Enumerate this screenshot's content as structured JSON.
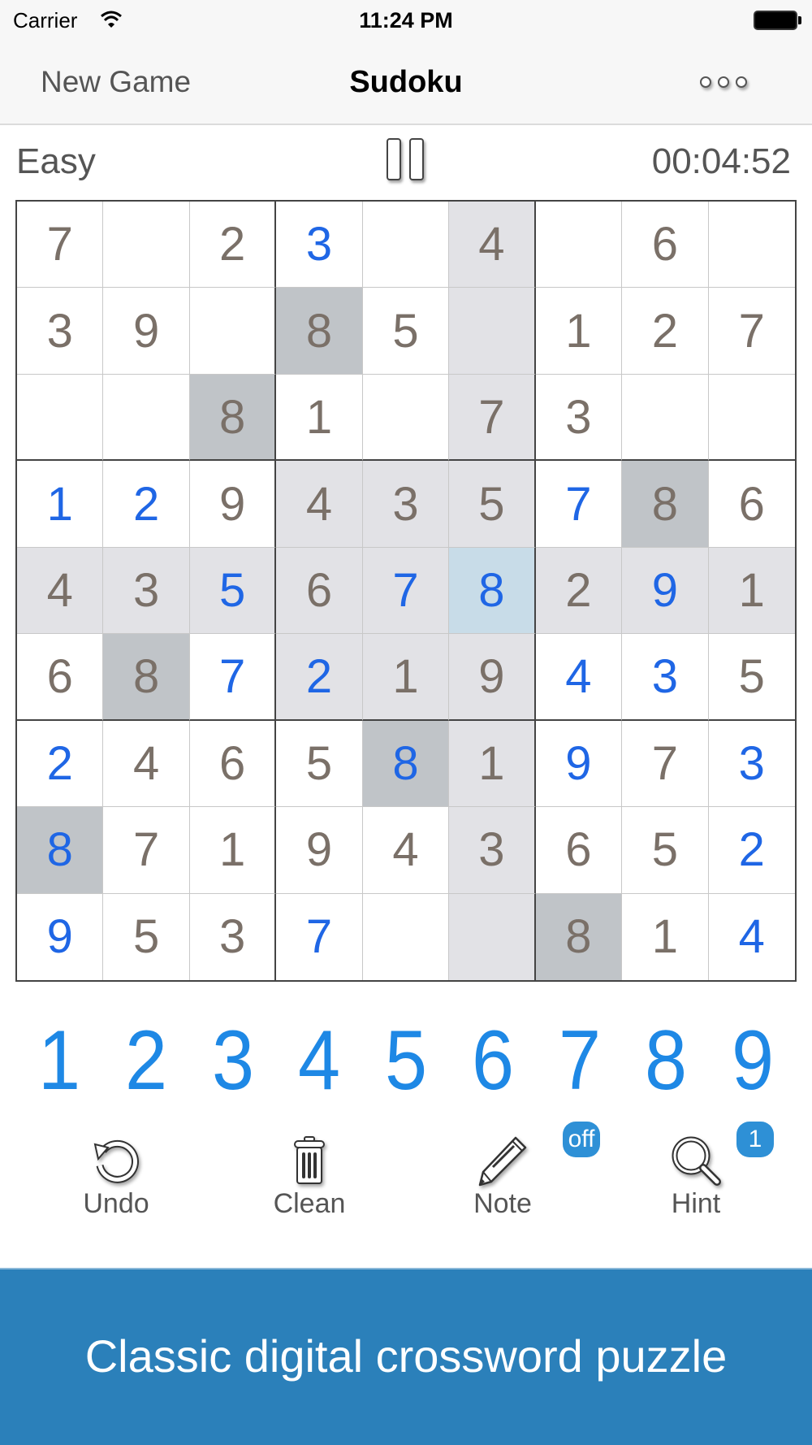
{
  "status_bar": {
    "carrier": "Carrier",
    "time": "11:24 PM",
    "icons": [
      "wifi-icon",
      "battery-icon"
    ]
  },
  "nav": {
    "left_button": "New Game",
    "title": "Sudoku",
    "right_button_icon": "more-dots-icon"
  },
  "game_info": {
    "difficulty": "Easy",
    "pause_icon": "pause-icon",
    "timer": "00:04:52"
  },
  "colors": {
    "given_digit": "#7a7068",
    "user_digit": "#1f66e5",
    "highlight_bg": "#e2e2e6",
    "same_number_bg": "#c0c4c8",
    "selected_bg": "#c8dce8",
    "numpad": "#1e88e5",
    "badge": "#2e90d6",
    "banner": "#2b80ba"
  },
  "board": {
    "selected": {
      "row": 5,
      "col": 6,
      "value": "8"
    },
    "legend": {
      "g": "given",
      "u": "user-entered",
      "bg_w": "white",
      "bg_l": "row/col/box highlight",
      "bg_d": "same-number highlight",
      "bg_s": "selected"
    },
    "rows": [
      [
        [
          "7",
          "g",
          "w"
        ],
        [
          "",
          "g",
          "w"
        ],
        [
          "2",
          "g",
          "w"
        ],
        [
          "3",
          "u",
          "w"
        ],
        [
          "",
          "g",
          "w"
        ],
        [
          "4",
          "g",
          "l"
        ],
        [
          "",
          "g",
          "w"
        ],
        [
          "6",
          "g",
          "w"
        ],
        [
          "",
          "g",
          "w"
        ]
      ],
      [
        [
          "3",
          "g",
          "w"
        ],
        [
          "9",
          "g",
          "w"
        ],
        [
          "",
          "g",
          "w"
        ],
        [
          "8",
          "g",
          "d"
        ],
        [
          "5",
          "g",
          "w"
        ],
        [
          "",
          "g",
          "l"
        ],
        [
          "1",
          "g",
          "w"
        ],
        [
          "2",
          "g",
          "w"
        ],
        [
          "7",
          "g",
          "w"
        ]
      ],
      [
        [
          "",
          "g",
          "w"
        ],
        [
          "",
          "g",
          "w"
        ],
        [
          "8",
          "g",
          "d"
        ],
        [
          "1",
          "g",
          "w"
        ],
        [
          "",
          "g",
          "w"
        ],
        [
          "7",
          "g",
          "l"
        ],
        [
          "3",
          "g",
          "w"
        ],
        [
          "",
          "g",
          "w"
        ],
        [
          "",
          "g",
          "w"
        ]
      ],
      [
        [
          "1",
          "u",
          "w"
        ],
        [
          "2",
          "u",
          "w"
        ],
        [
          "9",
          "g",
          "w"
        ],
        [
          "4",
          "g",
          "l"
        ],
        [
          "3",
          "g",
          "l"
        ],
        [
          "5",
          "g",
          "l"
        ],
        [
          "7",
          "u",
          "w"
        ],
        [
          "8",
          "g",
          "d"
        ],
        [
          "6",
          "g",
          "w"
        ]
      ],
      [
        [
          "4",
          "g",
          "l"
        ],
        [
          "3",
          "g",
          "l"
        ],
        [
          "5",
          "u",
          "l"
        ],
        [
          "6",
          "g",
          "l"
        ],
        [
          "7",
          "u",
          "l"
        ],
        [
          "8",
          "u",
          "s"
        ],
        [
          "2",
          "g",
          "l"
        ],
        [
          "9",
          "u",
          "l"
        ],
        [
          "1",
          "g",
          "l"
        ]
      ],
      [
        [
          "6",
          "g",
          "w"
        ],
        [
          "8",
          "g",
          "d"
        ],
        [
          "7",
          "u",
          "w"
        ],
        [
          "2",
          "u",
          "l"
        ],
        [
          "1",
          "g",
          "l"
        ],
        [
          "9",
          "g",
          "l"
        ],
        [
          "4",
          "u",
          "w"
        ],
        [
          "3",
          "u",
          "w"
        ],
        [
          "5",
          "g",
          "w"
        ]
      ],
      [
        [
          "2",
          "u",
          "w"
        ],
        [
          "4",
          "g",
          "w"
        ],
        [
          "6",
          "g",
          "w"
        ],
        [
          "5",
          "g",
          "w"
        ],
        [
          "8",
          "u",
          "d"
        ],
        [
          "1",
          "g",
          "l"
        ],
        [
          "9",
          "u",
          "w"
        ],
        [
          "7",
          "g",
          "w"
        ],
        [
          "3",
          "u",
          "w"
        ]
      ],
      [
        [
          "8",
          "u",
          "d"
        ],
        [
          "7",
          "g",
          "w"
        ],
        [
          "1",
          "g",
          "w"
        ],
        [
          "9",
          "g",
          "w"
        ],
        [
          "4",
          "g",
          "w"
        ],
        [
          "3",
          "g",
          "l"
        ],
        [
          "6",
          "g",
          "w"
        ],
        [
          "5",
          "g",
          "w"
        ],
        [
          "2",
          "u",
          "w"
        ]
      ],
      [
        [
          "9",
          "u",
          "w"
        ],
        [
          "5",
          "g",
          "w"
        ],
        [
          "3",
          "g",
          "w"
        ],
        [
          "7",
          "u",
          "w"
        ],
        [
          "",
          "g",
          "w"
        ],
        [
          "",
          "g",
          "l"
        ],
        [
          "8",
          "g",
          "d"
        ],
        [
          "1",
          "g",
          "w"
        ],
        [
          "4",
          "u",
          "w"
        ]
      ]
    ]
  },
  "numpad": [
    "1",
    "2",
    "3",
    "4",
    "5",
    "6",
    "7",
    "8",
    "9"
  ],
  "toolbar": {
    "undo": {
      "label": "Undo",
      "icon": "undo-icon"
    },
    "clean": {
      "label": "Clean",
      "icon": "trash-icon"
    },
    "note": {
      "label": "Note",
      "icon": "pencil-icon",
      "badge": "off"
    },
    "hint": {
      "label": "Hint",
      "icon": "magnifier-icon",
      "badge": "1"
    }
  },
  "banner": {
    "text": "Classic digital crossword puzzle"
  }
}
